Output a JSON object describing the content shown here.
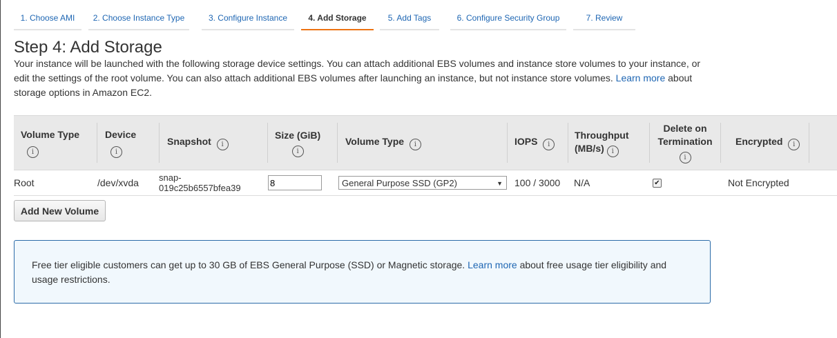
{
  "wizard": {
    "tabs": [
      {
        "label": "1. Choose AMI"
      },
      {
        "label": "2. Choose Instance Type"
      },
      {
        "label": "3. Configure Instance"
      },
      {
        "label": "4. Add Storage"
      },
      {
        "label": "5. Add Tags"
      },
      {
        "label": "6. Configure Security Group"
      },
      {
        "label": "7. Review"
      }
    ]
  },
  "page": {
    "title": "Step 4: Add Storage",
    "intro_text": "Your instance will be launched with the following storage device settings. You can attach additional EBS volumes and instance store volumes to your instance, or edit the settings of the root volume. You can also attach additional EBS volumes after launching an instance, but not instance store volumes.",
    "intro_link": "Learn more",
    "intro_suffix": "about storage options in Amazon EC2."
  },
  "table": {
    "headers": {
      "volume_type": "Volume Type",
      "device": "Device",
      "snapshot": "Snapshot",
      "size": "Size (GiB)",
      "ebs_volume_type": "Volume Type",
      "iops": "IOPS",
      "throughput": "Throughput (MB/s)",
      "delete_on_termination": "Delete on Termination",
      "encrypted": "Encrypted"
    },
    "info_glyph": "i",
    "rows": [
      {
        "volume_type": "Root",
        "device": "/dev/xvda",
        "snapshot": "snap-019c25b6557bfea39",
        "size": "8",
        "ebs_volume_type": "General Purpose SSD (GP2)",
        "iops": "100 / 3000",
        "throughput": "N/A",
        "delete_on_termination": true,
        "encrypted": "Not Encrypted"
      }
    ]
  },
  "actions": {
    "add_volume": "Add New Volume"
  },
  "notice": {
    "text": "Free tier eligible customers can get up to 30 GB of EBS General Purpose (SSD) or Magnetic storage.",
    "link": "Learn more",
    "suffix": "about free usage tier eligibility and usage restrictions."
  },
  "colors": {
    "link": "#1e66b3",
    "active_tab_underline": "#ec7211",
    "notice_border": "#2a6aa8",
    "notice_bg": "#f1f8fd",
    "header_bg": "#e9e9e9"
  },
  "icons": {
    "info": "info-circle-icon",
    "dropdown": "caret-down-icon",
    "checkbox": "checkmark-icon"
  }
}
